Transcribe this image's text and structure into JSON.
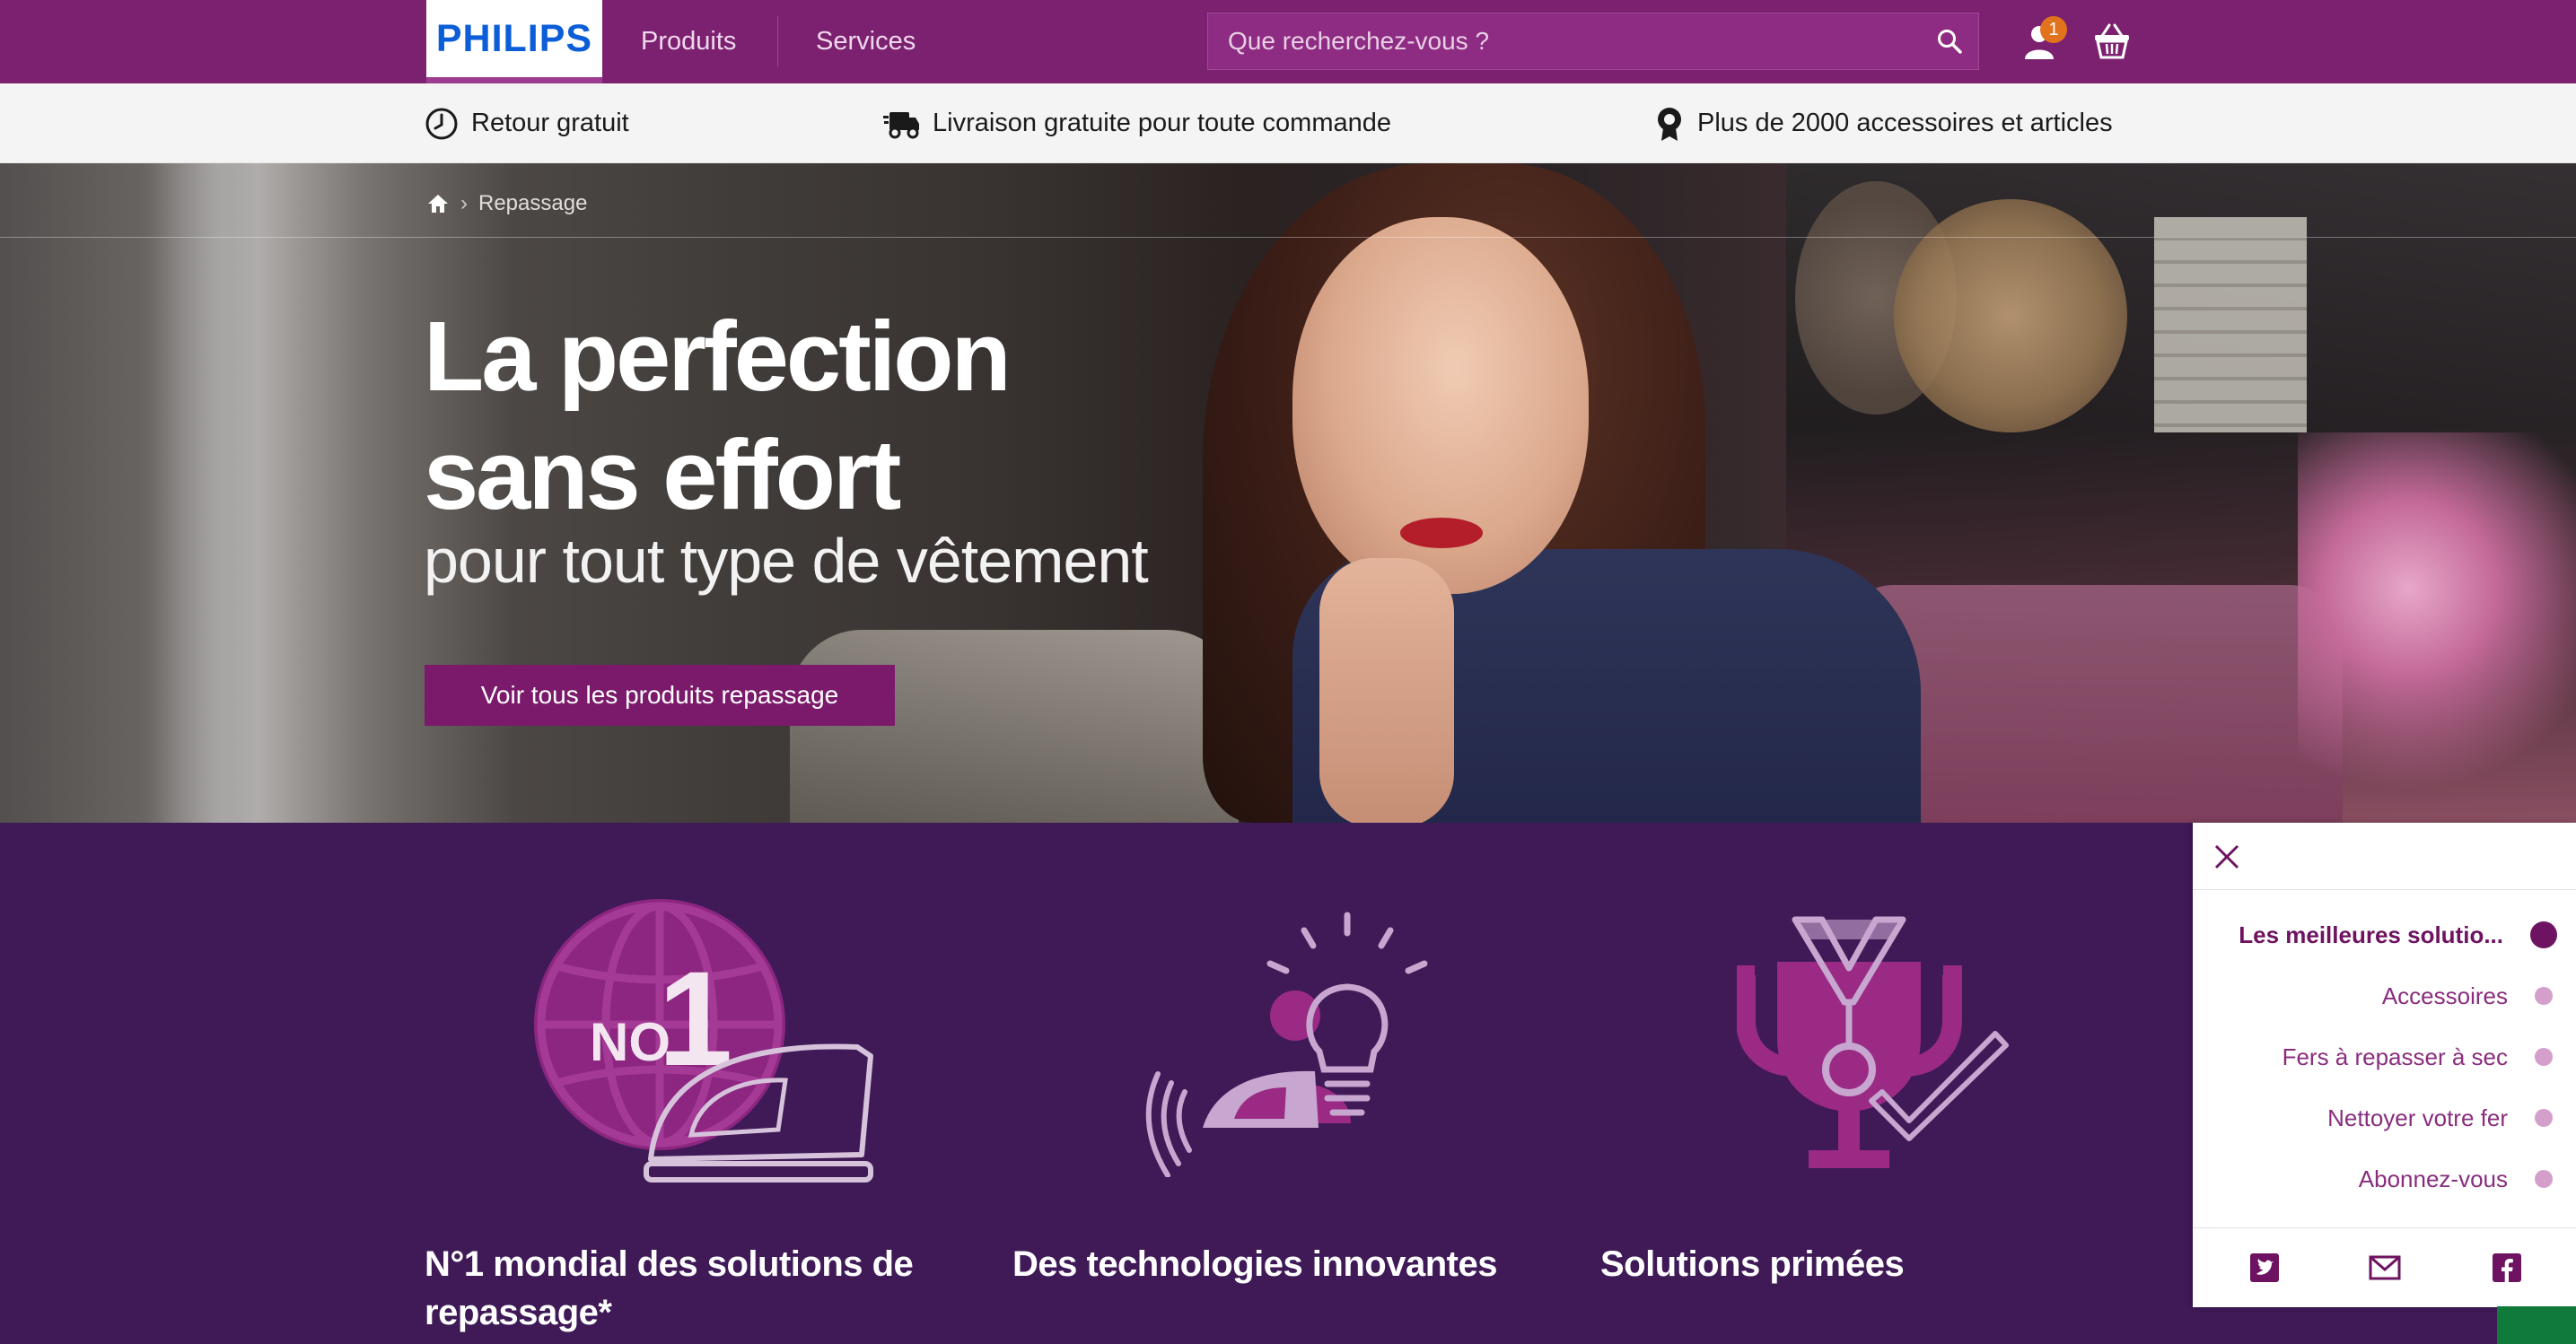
{
  "header": {
    "logo": "PHILIPS",
    "nav": [
      {
        "label": "Produits"
      },
      {
        "label": "Services"
      }
    ],
    "search": {
      "placeholder": "Que recherchez-vous ?",
      "value": ""
    },
    "user_badge_count": "1",
    "colors": {
      "brand": "#7b2170",
      "badge": "#e2731e",
      "logo": "#0b5ed7"
    }
  },
  "usp_bar": {
    "items": [
      {
        "icon": "clock-icon",
        "label": "Retour gratuit"
      },
      {
        "icon": "truck-icon",
        "label": "Livraison gratuite pour toute commande"
      },
      {
        "icon": "award-ribbon-icon",
        "label": "Plus de 2000 accessoires et articles"
      }
    ]
  },
  "hero": {
    "breadcrumb": {
      "home_icon": "home-icon",
      "current": "Repassage"
    },
    "title_line1": "La perfection",
    "title_line2": "sans effort",
    "subtitle": "pour tout type de vêtement",
    "cta_label": "Voir tous les produits repassage"
  },
  "features": {
    "items": [
      {
        "icon": "no1-globe-iron-icon",
        "badge_text": "NO",
        "badge_number": "1",
        "title_line1": "N°1 mondial des solutions de",
        "title_line2": "repassage*"
      },
      {
        "icon": "lightbulb-person-iron-icon",
        "title_line1": "Des technologies innovantes",
        "title_line2": ""
      },
      {
        "icon": "medal-trophy-check-icon",
        "title_line1": "Solutions primées",
        "title_line2": ""
      }
    ],
    "colors": {
      "background": "#3f1a57",
      "icon_pink": "#9a2a84",
      "icon_light": "#c7a7cf"
    }
  },
  "side_nav": {
    "items": [
      {
        "label": "Les meilleures solutio...",
        "active": true
      },
      {
        "label": "Accessoires",
        "active": false
      },
      {
        "label": "Fers à repasser à sec",
        "active": false
      },
      {
        "label": "Nettoyer votre fer",
        "active": false
      },
      {
        "label": "Abonnez-vous",
        "active": false
      }
    ],
    "social": [
      {
        "icon": "twitter-icon"
      },
      {
        "icon": "email-icon"
      },
      {
        "icon": "facebook-icon"
      }
    ],
    "colors": {
      "accent": "#6e1361",
      "dot": "#d59fcc"
    }
  }
}
